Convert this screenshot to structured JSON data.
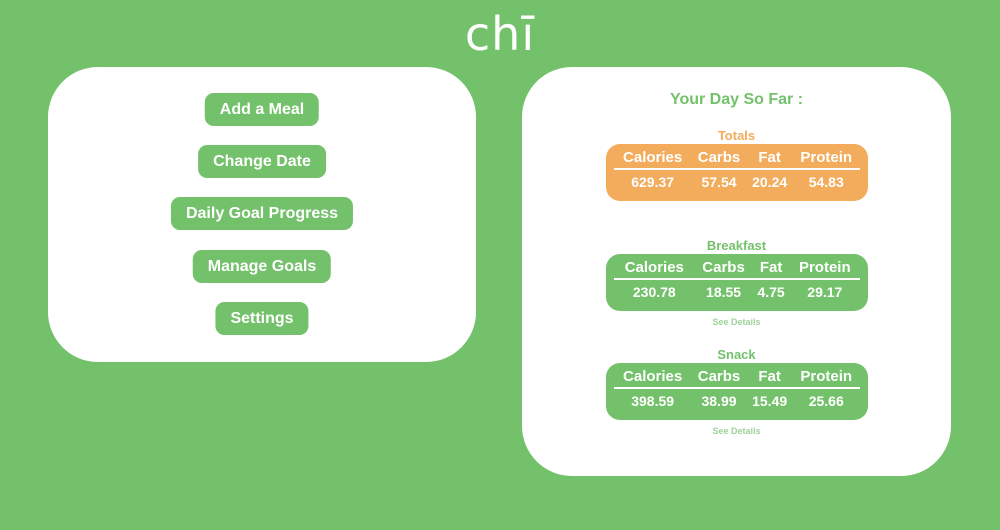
{
  "app": {
    "logo": "chī"
  },
  "menu": {
    "buttons": [
      {
        "label": "Add a Meal"
      },
      {
        "label": "Change Date"
      },
      {
        "label": "Daily Goal Progress"
      },
      {
        "label": "Manage Goals"
      },
      {
        "label": "Settings"
      }
    ]
  },
  "summary": {
    "title": "Your Day So Far :",
    "columns": [
      "Calories",
      "Carbs",
      "Fat",
      "Protein"
    ],
    "see_details_label": "See Details",
    "sections": [
      {
        "title": "Totals",
        "values": [
          "629.37",
          "57.54",
          "20.24",
          "54.83"
        ]
      },
      {
        "title": "Breakfast",
        "values": [
          "230.78",
          "18.55",
          "4.75",
          "29.17"
        ]
      },
      {
        "title": "Snack",
        "values": [
          "398.59",
          "38.99",
          "15.49",
          "25.66"
        ]
      }
    ]
  },
  "colors": {
    "background": "#74c16b",
    "panel": "#ffffff",
    "accent_orange": "#f2ac5c",
    "link_green": "#9fd29a"
  }
}
